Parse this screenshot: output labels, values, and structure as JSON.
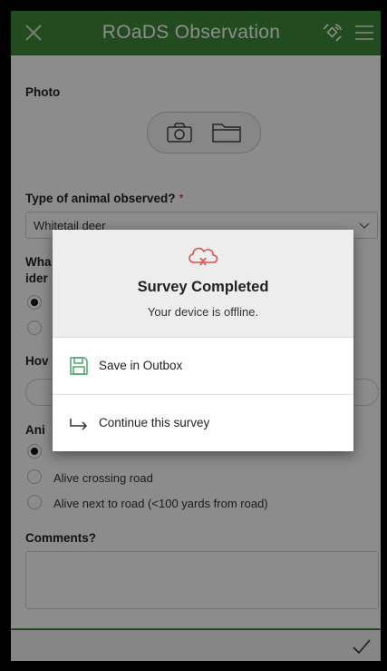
{
  "header": {
    "title": "ROaDS Observation",
    "close_icon": "close-icon",
    "gps_icon": "satellite-icon",
    "menu_icon": "hamburger-menu-icon",
    "color": "#3f8a3a"
  },
  "form": {
    "photo": {
      "label": "Photo",
      "camera_icon": "camera-icon",
      "folder_icon": "folder-icon"
    },
    "animal_type": {
      "label": "Type of animal observed?",
      "required_mark": "*",
      "selected_value": "Whitetail deer"
    },
    "identification": {
      "label_line1": "Wha",
      "label_line2": "ider"
    },
    "how": {
      "label": "Hov"
    },
    "animal_state": {
      "label": "Ani",
      "options": [
        {
          "label": "Alive crossing road",
          "selected": false
        },
        {
          "label": "Alive next to road (<100 yards from road)",
          "selected": false
        }
      ]
    },
    "comments": {
      "label": "Comments?"
    }
  },
  "dialog": {
    "icon": "cloud-offline-icon",
    "title": "Survey Completed",
    "message": "Your device is offline.",
    "options": [
      {
        "label": "Save in Outbox",
        "icon": "save-icon"
      },
      {
        "label": "Continue this survey",
        "icon": "arrow-return-icon"
      }
    ]
  },
  "footer": {
    "submit_icon": "checkmark-icon"
  },
  "colors": {
    "accent": "#3f8a3a",
    "required": "#d2322d",
    "alert": "#d9534f",
    "save_icon": "#4aa56a"
  }
}
